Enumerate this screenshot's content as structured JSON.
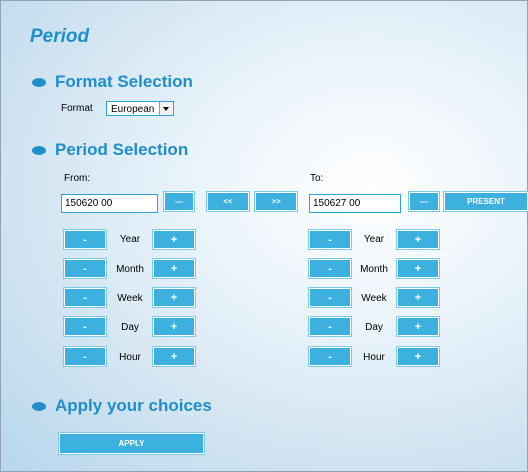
{
  "page": {
    "title": "Period"
  },
  "format_section": {
    "title": "Format Selection",
    "format_label": "Format",
    "format_value": "European"
  },
  "period_section": {
    "title": "Period Selection",
    "from": {
      "label": "From:",
      "value": "150620 00",
      "picker_label": "---"
    },
    "to": {
      "label": "To:",
      "value": "150627 00",
      "picker_label": "---"
    },
    "prev_label": "<<",
    "next_label": ">>",
    "present_label": "PRESENT",
    "units": [
      "Year",
      "Month",
      "Week",
      "Day",
      "Hour"
    ],
    "minus_label": "-",
    "plus_label": "+"
  },
  "apply_section": {
    "title": "Apply your choices",
    "apply_label": "APPLY"
  },
  "colors": {
    "accent": "#1f8ecb",
    "button": "#3cb0de"
  }
}
